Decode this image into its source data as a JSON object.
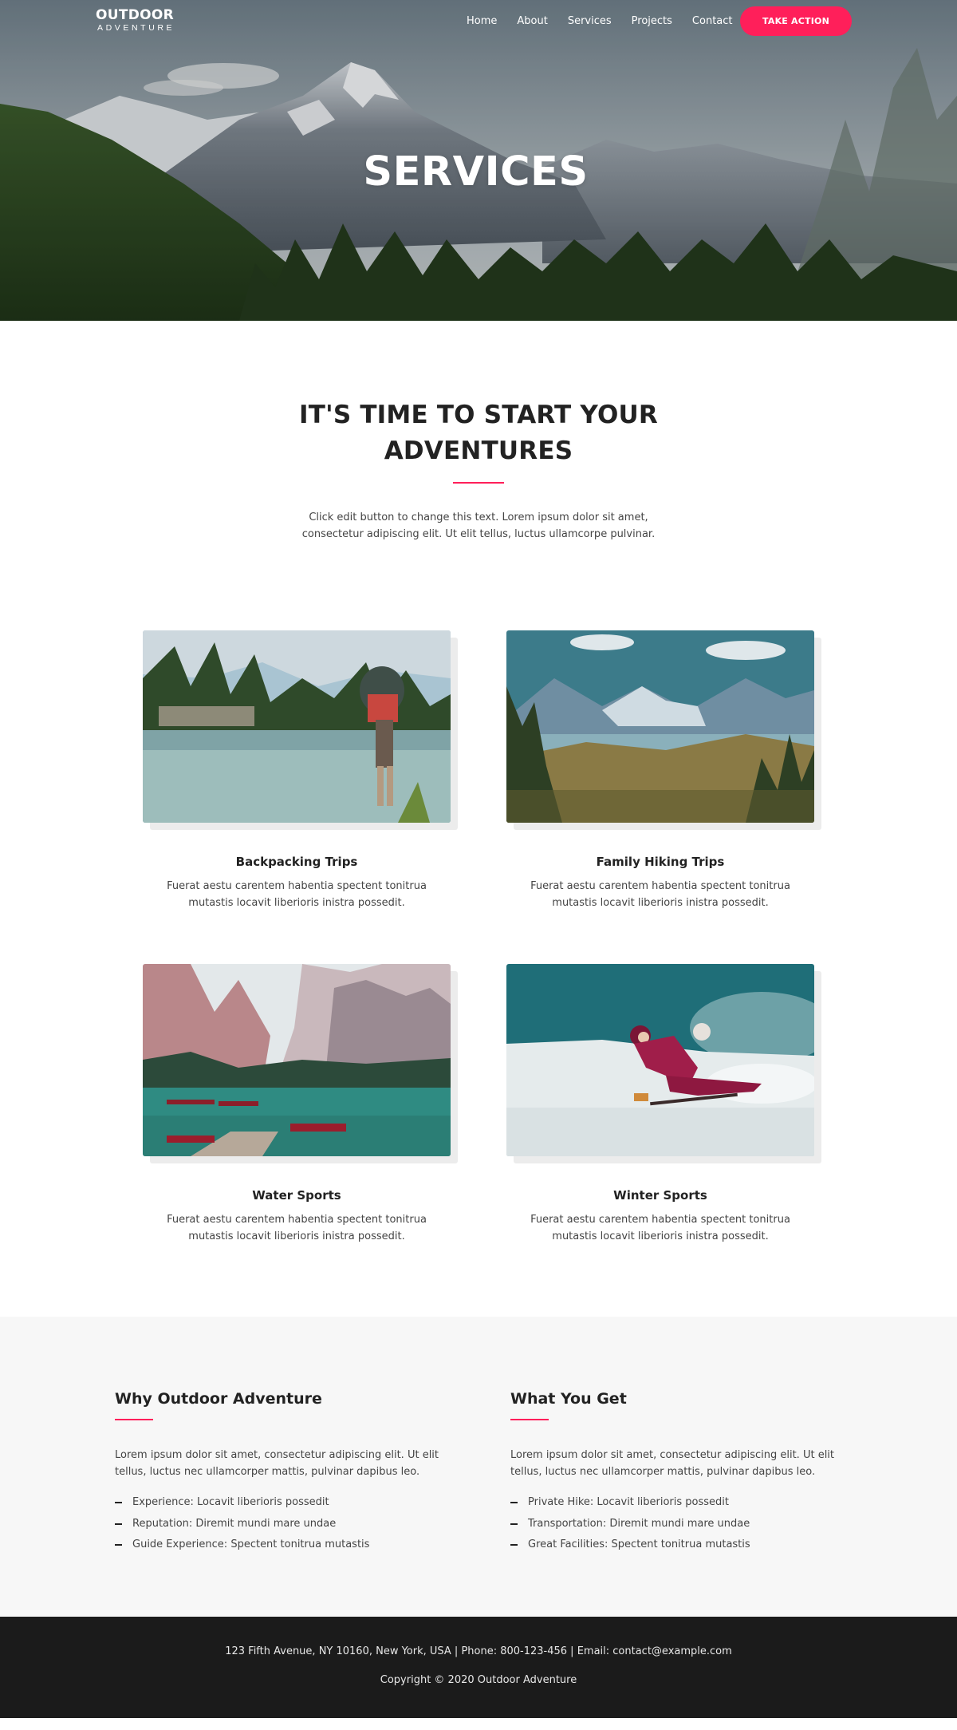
{
  "brand": {
    "name": "OUTDOOR",
    "tagline": "ADVENTURE"
  },
  "nav": {
    "items": [
      {
        "label": "Home"
      },
      {
        "label": "About"
      },
      {
        "label": "Services"
      },
      {
        "label": "Projects"
      },
      {
        "label": "Contact"
      }
    ],
    "cta_label": "TAKE ACTION"
  },
  "hero": {
    "title": "SERVICES"
  },
  "intro": {
    "heading": "IT'S TIME TO START YOUR ADVENTURES",
    "text": "Click edit button to change this text. Lorem ipsum dolor sit amet, consectetur adipiscing elit. Ut elit tellus, luctus ullamcorpe pulvinar."
  },
  "services": [
    {
      "title": "Backpacking Trips",
      "text": "Fuerat aestu carentem habentia spectent tonitrua mutastis locavit liberioris inistra possedit."
    },
    {
      "title": "Family Hiking Trips",
      "text": "Fuerat aestu carentem habentia spectent tonitrua mutastis locavit liberioris inistra possedit."
    },
    {
      "title": "Water Sports",
      "text": "Fuerat aestu carentem habentia spectent tonitrua mutastis locavit liberioris inistra possedit."
    },
    {
      "title": "Winter Sports",
      "text": "Fuerat aestu carentem habentia spectent tonitrua mutastis locavit liberioris inistra possedit."
    }
  ],
  "why": {
    "heading": "Why Outdoor Adventure",
    "text": "Lorem ipsum dolor sit amet, consectetur adipiscing elit. Ut elit tellus, luctus nec ullamcorper mattis, pulvinar dapibus leo.",
    "items": [
      "Experience: Locavit liberioris possedit",
      "Reputation: Diremit mundi mare undae",
      "Guide Experience: Spectent tonitrua mutastis"
    ]
  },
  "what": {
    "heading": "What You Get",
    "text": "Lorem ipsum dolor sit amet, consectetur adipiscing elit. Ut elit tellus, luctus nec ullamcorper mattis, pulvinar dapibus leo.",
    "items": [
      "Private Hike: Locavit liberioris possedit",
      "Transportation: Diremit mundi mare undae",
      "Great Facilities: Spectent tonitrua mutastis"
    ]
  },
  "footer": {
    "address": "123 Fifth Avenue, NY 10160, New York, USA | Phone: 800-123-456 | Email: contact@example.com",
    "copyright": "Copyright © 2020 Outdoor Adventure"
  },
  "colors": {
    "accent": "#ff1f5a",
    "footer_bg": "#1b1b1b",
    "section_bg": "#f7f7f7",
    "heading": "#222222"
  }
}
